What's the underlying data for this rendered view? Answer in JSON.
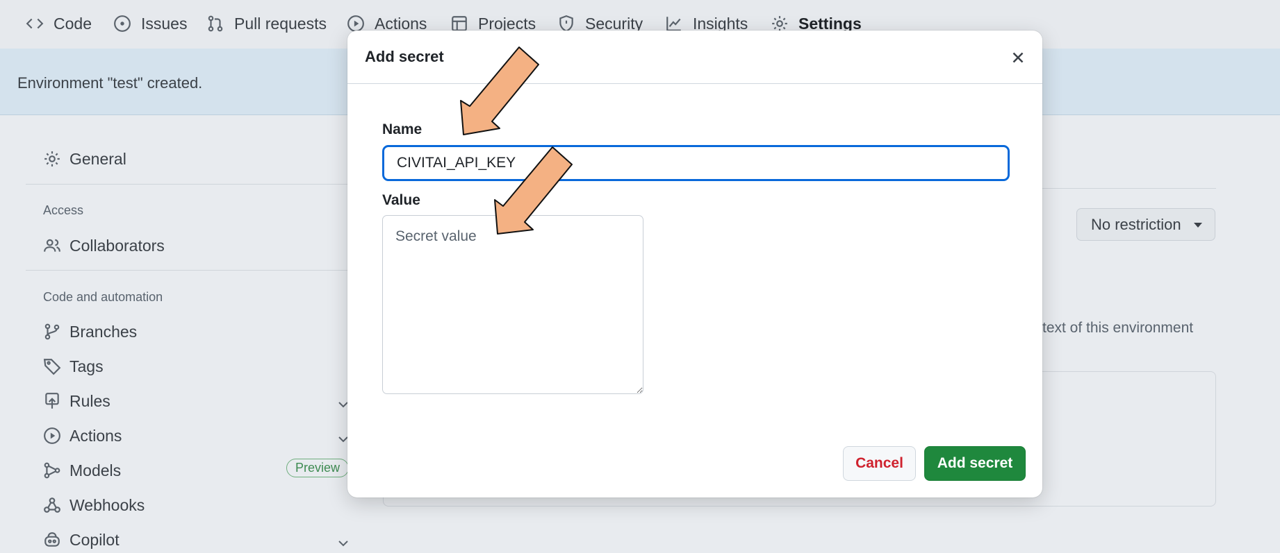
{
  "topnav": {
    "items": [
      {
        "label": "Code",
        "icon": "code-icon"
      },
      {
        "label": "Issues",
        "icon": "issue-icon"
      },
      {
        "label": "Pull requests",
        "icon": "pull-request-icon"
      },
      {
        "label": "Actions",
        "icon": "play-icon"
      },
      {
        "label": "Projects",
        "icon": "table-icon"
      },
      {
        "label": "Security",
        "icon": "shield-icon"
      },
      {
        "label": "Insights",
        "icon": "graph-icon"
      },
      {
        "label": "Settings",
        "icon": "gear-icon",
        "active": true
      }
    ]
  },
  "flash": {
    "message": "Environment \"test\" created."
  },
  "sidebar": {
    "general": "General",
    "access_heading": "Access",
    "collaborators": "Collaborators",
    "automation_heading": "Code and automation",
    "items": [
      {
        "label": "Branches",
        "icon": "branch-icon"
      },
      {
        "label": "Tags",
        "icon": "tag-icon"
      },
      {
        "label": "Rules",
        "icon": "rules-icon",
        "expandable": true
      },
      {
        "label": "Actions",
        "icon": "play-icon",
        "expandable": true
      },
      {
        "label": "Models",
        "icon": "models-icon",
        "badge": "Preview"
      },
      {
        "label": "Webhooks",
        "icon": "webhook-icon"
      },
      {
        "label": "Copilot",
        "icon": "copilot-icon",
        "expandable": true
      }
    ]
  },
  "background": {
    "deployment_branches_select": "No restriction",
    "description_fragment": "text of this environment"
  },
  "modal": {
    "title": "Add secret",
    "name_label": "Name",
    "name_value": "CIVITAI_API_KEY",
    "value_label": "Value",
    "value_placeholder": "Secret value",
    "cancel_label": "Cancel",
    "submit_label": "Add secret"
  },
  "colors": {
    "accent": "#0969da",
    "primary_button": "#1f883d",
    "danger_text": "#cf222e",
    "annotation_arrow": "#f4b183"
  }
}
